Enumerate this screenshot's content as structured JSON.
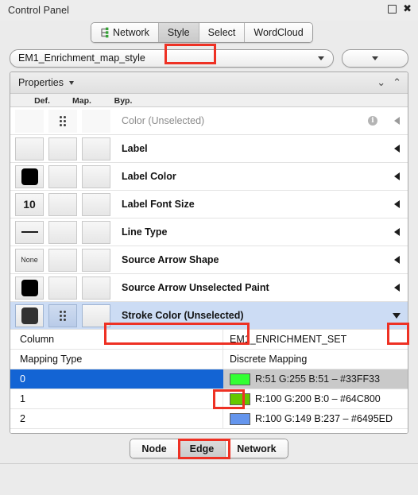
{
  "window": {
    "title": "Control Panel",
    "float_icon": "float-window-icon",
    "close_icon": "close-icon"
  },
  "top_tabs": [
    {
      "label": "Network",
      "icon": "network-graph-icon",
      "active": false,
      "highlighted": false
    },
    {
      "label": "Style",
      "icon": "",
      "active": true,
      "highlighted": true
    },
    {
      "label": "Select",
      "icon": "",
      "active": false,
      "highlighted": false
    },
    {
      "label": "WordCloud",
      "icon": "",
      "active": false,
      "highlighted": false
    }
  ],
  "style_selector": {
    "value": "EM1_Enrichment_map_style",
    "caret_icon": "chevron-down-icon",
    "options_button_icon": "chevron-down-icon"
  },
  "properties_panel": {
    "title": "Properties",
    "title_caret_icon": "chevron-down-icon",
    "expand_all_icon": "double-chevron-down-icon",
    "collapse_all_icon": "double-chevron-up-icon",
    "columns": [
      "Def.",
      "Map.",
      "Byp."
    ],
    "rows": [
      {
        "label": "Color (Unselected)",
        "def": {
          "type": "empty"
        },
        "map": {
          "type": "dots"
        },
        "byp": {
          "type": "empty"
        },
        "info_icon": "info-icon",
        "expander_icon": "triangle-left-icon",
        "muted": true,
        "selected": false
      },
      {
        "label": "Label",
        "def": {
          "type": "empty"
        },
        "map": {
          "type": "empty"
        },
        "byp": {
          "type": "empty"
        },
        "expander_icon": "triangle-left-icon",
        "muted": false,
        "selected": false
      },
      {
        "label": "Label Color",
        "def": {
          "type": "swatch",
          "color": "#000000"
        },
        "map": {
          "type": "empty"
        },
        "byp": {
          "type": "empty"
        },
        "expander_icon": "triangle-left-icon",
        "muted": false,
        "selected": false
      },
      {
        "label": "Label Font Size",
        "def": {
          "type": "number",
          "value": "10"
        },
        "map": {
          "type": "empty"
        },
        "byp": {
          "type": "empty"
        },
        "expander_icon": "triangle-left-icon",
        "muted": false,
        "selected": false
      },
      {
        "label": "Line Type",
        "def": {
          "type": "line"
        },
        "map": {
          "type": "empty"
        },
        "byp": {
          "type": "empty"
        },
        "expander_icon": "triangle-left-icon",
        "muted": false,
        "selected": false
      },
      {
        "label": "Source Arrow Shape",
        "def": {
          "type": "text",
          "value": "None"
        },
        "map": {
          "type": "empty"
        },
        "byp": {
          "type": "empty"
        },
        "expander_icon": "triangle-left-icon",
        "muted": false,
        "selected": false
      },
      {
        "label": "Source Arrow Unselected Paint",
        "def": {
          "type": "swatch",
          "color": "#000000"
        },
        "map": {
          "type": "empty"
        },
        "byp": {
          "type": "empty"
        },
        "expander_icon": "triangle-left-icon",
        "muted": false,
        "selected": false
      },
      {
        "label": "Stroke Color (Unselected)",
        "def": {
          "type": "swatch",
          "color": "#323232"
        },
        "map": {
          "type": "dots"
        },
        "byp": {
          "type": "empty"
        },
        "expander_icon": "triangle-down-icon",
        "muted": false,
        "selected": true,
        "highlighted": true
      }
    ]
  },
  "mapping_detail": {
    "column_label": "Column",
    "column_value": "EM1_ENRICHMENT_SET",
    "mapping_type_label": "Mapping Type",
    "mapping_type_value": "Discrete Mapping",
    "entries": [
      {
        "key": "0",
        "swatch": "#33FF33",
        "value": "R:51 G:255 B:51 – #33FF33",
        "selected": true,
        "highlighted": true
      },
      {
        "key": "1",
        "swatch": "#64C800",
        "value": "R:100 G:200 B:0 – #64C800",
        "selected": false,
        "highlighted": false
      },
      {
        "key": "2",
        "swatch": "#6495ED",
        "value": "R:100 G:149 B:237 – #6495ED",
        "selected": false,
        "highlighted": false
      }
    ]
  },
  "bottom_tabs": [
    {
      "label": "Node",
      "active": false,
      "highlighted": false
    },
    {
      "label": "Edge",
      "active": true,
      "highlighted": true
    },
    {
      "label": "Network",
      "active": false,
      "highlighted": false
    }
  ],
  "colors": {
    "annotation": "#EE3124",
    "row_selection": "#1364D4",
    "prop_row_selection": "#CCDCF4"
  }
}
